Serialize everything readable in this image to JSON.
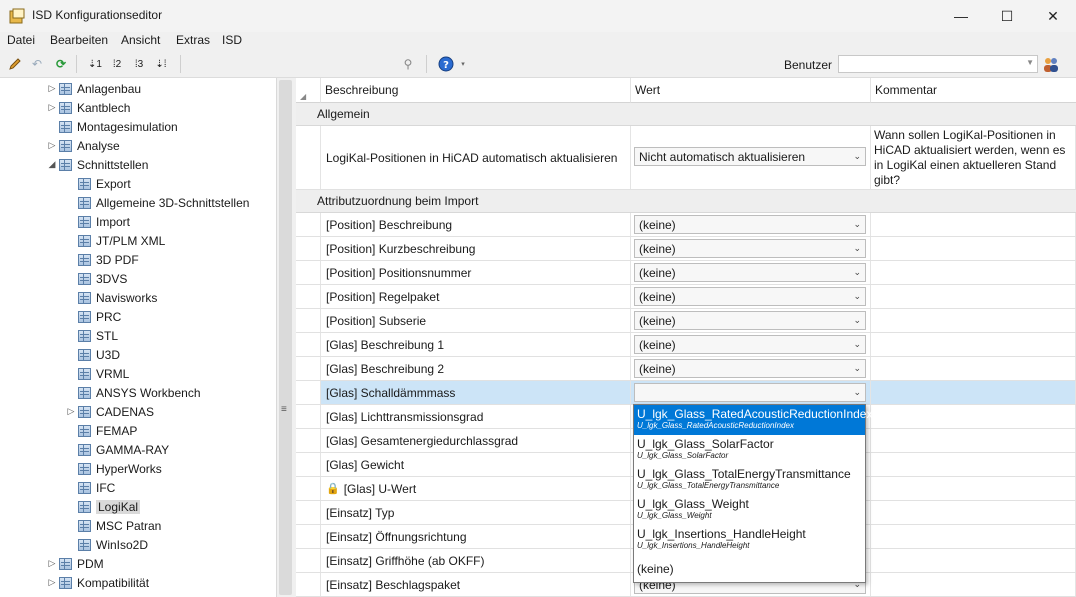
{
  "window": {
    "title": "ISD Konfigurationseditor"
  },
  "menu": [
    "Datei",
    "Bearbeiten",
    "Ansicht",
    "Extras",
    "ISD"
  ],
  "toolbar": {
    "user_label": "Benutzer",
    "user_value": ""
  },
  "tree": {
    "items": [
      {
        "label": "Anlagenbau",
        "level": 1,
        "expander": "▷"
      },
      {
        "label": "Kantblech",
        "level": 1,
        "expander": "▷"
      },
      {
        "label": "Montagesimulation",
        "level": 1,
        "expander": ""
      },
      {
        "label": "Analyse",
        "level": 1,
        "expander": "▷"
      },
      {
        "label": "Schnittstellen",
        "level": 1,
        "expander": "◢"
      },
      {
        "label": "Export",
        "level": 2,
        "expander": ""
      },
      {
        "label": "Allgemeine 3D-Schnittstellen",
        "level": 2,
        "expander": ""
      },
      {
        "label": "Import",
        "level": 2,
        "expander": ""
      },
      {
        "label": "JT/PLM XML",
        "level": 2,
        "expander": ""
      },
      {
        "label": "3D PDF",
        "level": 2,
        "expander": ""
      },
      {
        "label": "3DVS",
        "level": 2,
        "expander": ""
      },
      {
        "label": "Navisworks",
        "level": 2,
        "expander": ""
      },
      {
        "label": "PRC",
        "level": 2,
        "expander": ""
      },
      {
        "label": "STL",
        "level": 2,
        "expander": ""
      },
      {
        "label": "U3D",
        "level": 2,
        "expander": ""
      },
      {
        "label": "VRML",
        "level": 2,
        "expander": ""
      },
      {
        "label": "ANSYS Workbench",
        "level": 2,
        "expander": ""
      },
      {
        "label": "CADENAS",
        "level": 2,
        "expander": "▷"
      },
      {
        "label": "FEMAP",
        "level": 2,
        "expander": ""
      },
      {
        "label": "GAMMA-RAY",
        "level": 2,
        "expander": ""
      },
      {
        "label": "HyperWorks",
        "level": 2,
        "expander": ""
      },
      {
        "label": "IFC",
        "level": 2,
        "expander": ""
      },
      {
        "label": "LogiKal",
        "level": 2,
        "expander": "",
        "selected": true
      },
      {
        "label": "MSC Patran",
        "level": 2,
        "expander": ""
      },
      {
        "label": "WinIso2D",
        "level": 2,
        "expander": ""
      },
      {
        "label": "PDM",
        "level": 1,
        "expander": "▷"
      },
      {
        "label": "Kompatibilität",
        "level": 1,
        "expander": "▷"
      }
    ]
  },
  "grid": {
    "headers": [
      "Beschreibung",
      "Wert",
      "Kommentar"
    ],
    "section1": "Allgemein",
    "logikal_row": {
      "label": "LogiKal-Positionen in HiCAD automatisch aktualisieren",
      "value": "Nicht automatisch aktualisieren",
      "comment": "Wann sollen LogiKal-Positionen in HiCAD aktualisiert werden, wenn es in LogiKal einen aktuelleren Stand gibt?"
    },
    "section2": "Attributzuordnung beim Import",
    "rows": [
      {
        "label": "[Position] Beschreibung",
        "value": "(keine)"
      },
      {
        "label": "[Position] Kurzbeschreibung",
        "value": "(keine)"
      },
      {
        "label": "[Position] Positionsnummer",
        "value": "(keine)"
      },
      {
        "label": "[Position] Regelpaket",
        "value": "(keine)"
      },
      {
        "label": "[Position] Subserie",
        "value": "(keine)"
      },
      {
        "label": "[Glas] Beschreibung 1",
        "value": "(keine)"
      },
      {
        "label": "[Glas] Beschreibung 2",
        "value": "(keine)"
      },
      {
        "label": "[Glas] Schalldämmmass",
        "value": "",
        "highlight": true
      },
      {
        "label": "[Glas] Lichttransmissionsgrad",
        "value": ""
      },
      {
        "label": "[Glas] Gesamtenergiedurchlassgrad",
        "value": ""
      },
      {
        "label": "[Glas] Gewicht",
        "value": ""
      },
      {
        "label": "[Glas] U-Wert",
        "value": "",
        "locked": true
      },
      {
        "label": "[Einsatz] Typ",
        "value": ""
      },
      {
        "label": "[Einsatz] Öffnungsrichtung",
        "value": ""
      },
      {
        "label": "[Einsatz] Griffhöhe (ab OKFF)",
        "value": ""
      },
      {
        "label": "[Einsatz] Beschlagspaket",
        "value": "(keine)"
      }
    ]
  },
  "dropdown": {
    "items": [
      {
        "main": "U_lgk_Glass_RatedAcousticReductionIndex",
        "sub": "U_lgk_Glass_RatedAcousticReductionIndex",
        "selected": true
      },
      {
        "main": "U_lgk_Glass_SolarFactor",
        "sub": "U_lgk_Glass_SolarFactor"
      },
      {
        "main": "U_lgk_Glass_TotalEnergyTransmittance",
        "sub": "U_lgk_Glass_TotalEnergyTransmittance"
      },
      {
        "main": "U_lgk_Glass_Weight",
        "sub": "U_lgk_Glass_Weight"
      },
      {
        "main": "U_lgk_Insertions_HandleHeight",
        "sub": "U_lgk_Insertions_HandleHeight"
      },
      {
        "main": "(keine)",
        "sub": ""
      }
    ]
  }
}
